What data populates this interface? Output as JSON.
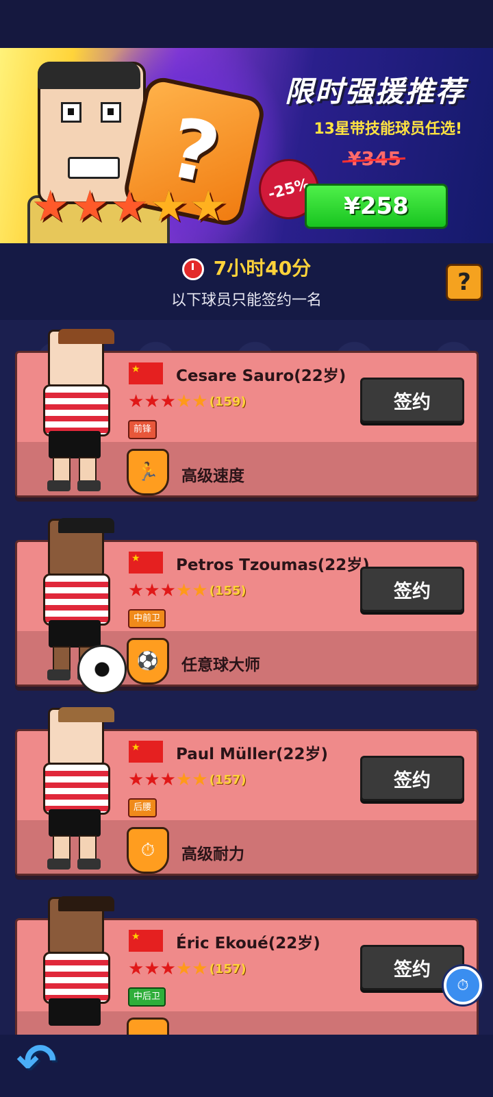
{
  "banner": {
    "title": "限时强援推荐",
    "subtitle": "13星带技能球员任选!",
    "old_price": "¥345",
    "discount": "-25%",
    "price": "¥258",
    "mystery_symbol": "?"
  },
  "timer": {
    "remaining": "7小时40分",
    "note": "以下球员只能签约一名"
  },
  "help_symbol": "?",
  "sign_label": "签约",
  "players": [
    {
      "name": "Cesare Sauro(22岁)",
      "rating": "(159)",
      "stars": 5,
      "position": "前锋",
      "position_color": "#e8573a",
      "skill": "高级速度",
      "skill_icon": "runner-icon"
    },
    {
      "name": "Petros Tzoumas(22岁)",
      "rating": "(155)",
      "stars": 5,
      "position": "中前卫",
      "position_color": "#f08a1a",
      "skill": "任意球大师",
      "skill_icon": "free-kick-icon"
    },
    {
      "name": "Paul Müller(22岁)",
      "rating": "(157)",
      "stars": 5,
      "position": "后腰",
      "position_color": "#f08a1a",
      "skill": "高级耐力",
      "skill_icon": "stamina-icon"
    },
    {
      "name": "Éric Ekoué(22岁)",
      "rating": "(157)",
      "stars": 5,
      "position": "中后卫",
      "position_color": "#2fae3a",
      "skill": "",
      "skill_icon": "eye-icon"
    }
  ]
}
